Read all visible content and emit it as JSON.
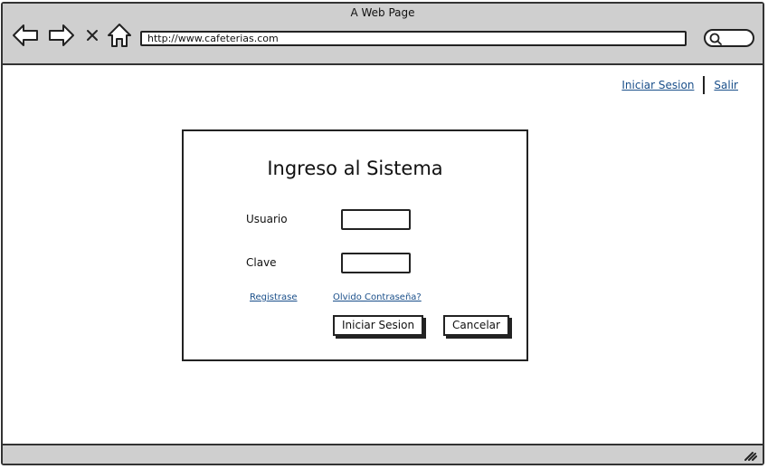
{
  "window": {
    "title": "A Web Page"
  },
  "toolbar": {
    "back_icon": "arrow-left-icon",
    "forward_icon": "arrow-right-icon",
    "stop_icon": "close-icon",
    "home_icon": "home-icon",
    "url": "http://www.cafeterias.com",
    "search_icon": "search-icon"
  },
  "top_nav": {
    "login_label": "Iniciar Sesion",
    "logout_label": "Salir"
  },
  "login": {
    "title": "Ingreso al Sistema",
    "username_label": "Usuario",
    "username_value": "",
    "password_label": "Clave",
    "password_value": "",
    "register_link": "Registrase",
    "forgot_link": "Olvido Contraseña?",
    "submit_label": "Iniciar Sesion",
    "cancel_label": "Cancelar"
  },
  "colors": {
    "chrome_gray": "#cfcfcf",
    "link_blue": "#1a4f8a",
    "stroke": "#222222"
  }
}
